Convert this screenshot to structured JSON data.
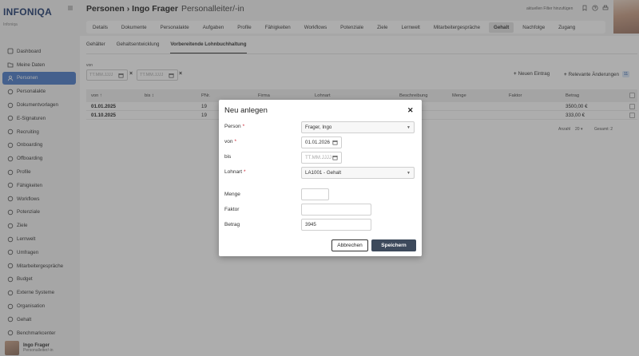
{
  "app": {
    "logo": "INFONIQA",
    "logo_sub": "Infoniqa"
  },
  "sidebar": {
    "items": [
      {
        "label": "Dashboard",
        "icon": "dashboard-icon"
      },
      {
        "label": "Meine Daten",
        "icon": "folder-icon"
      },
      {
        "label": "Personen",
        "icon": "person-icon"
      },
      {
        "label": "Personalakte",
        "icon": "file-icon"
      },
      {
        "label": "Dokumentvorlagen",
        "icon": "template-icon"
      },
      {
        "label": "E-Signaturen",
        "icon": "signature-icon"
      },
      {
        "label": "Recruiting",
        "icon": "recruiting-icon"
      },
      {
        "label": "Onboarding",
        "icon": "onboarding-icon"
      },
      {
        "label": "Offboarding",
        "icon": "offboarding-icon"
      },
      {
        "label": "Profile",
        "icon": "profile-icon"
      },
      {
        "label": "Fähigkeiten",
        "icon": "skills-icon"
      },
      {
        "label": "Workflows",
        "icon": "workflow-icon"
      },
      {
        "label": "Potenziale",
        "icon": "potential-icon"
      },
      {
        "label": "Ziele",
        "icon": "target-icon"
      },
      {
        "label": "Lernwelt",
        "icon": "learning-icon"
      },
      {
        "label": "Umfragen",
        "icon": "survey-icon"
      },
      {
        "label": "Mitarbeitergespräche",
        "icon": "conversation-icon"
      },
      {
        "label": "Budget",
        "icon": "budget-icon"
      },
      {
        "label": "Externe Systeme",
        "icon": "link-icon"
      },
      {
        "label": "Organisation",
        "icon": "organisation-icon"
      },
      {
        "label": "Gehalt",
        "icon": "salary-icon"
      },
      {
        "label": "Benchmarkcenter",
        "icon": "chart-icon"
      }
    ],
    "active_index": 2,
    "user": {
      "name": "Ingo Frager",
      "role": "Personalleiter/-in"
    }
  },
  "header": {
    "breadcrumb": "Personen › Ingo Frager",
    "role": "Personalleiter/-in",
    "filter_text": "aktuellen Filter hinzufügen"
  },
  "tabs": [
    "Details",
    "Dokumente",
    "Personalakte",
    "Aufgaben",
    "Profile",
    "Fähigkeiten",
    "Workflows",
    "Potenziale",
    "Ziele",
    "Lernwelt",
    "Mitarbeitergespräche",
    "Gehalt",
    "Nachfolge",
    "Zugang"
  ],
  "active_tab": "Gehalt",
  "subtabs": [
    "Gehälter",
    "Gehaltsentwicklung",
    "Vorbereitende Lohnbuchhaltung"
  ],
  "filter": {
    "von_label": "von",
    "placeholder": "TT.MM.JJJJ"
  },
  "actions": {
    "new_entry": "Neuen Eintrag",
    "relevant_changes": "Relevante Änderungen",
    "relevant_count": "11"
  },
  "table": {
    "headers": [
      "von ↑",
      "bis ↕",
      "PNr.",
      "Firma",
      "Lohnart",
      "Beschreibung",
      "Menge",
      "Faktor",
      "Betrag"
    ],
    "rows": [
      {
        "von": "01.01.2025",
        "pnr": "19",
        "betrag": "3500,00 €"
      },
      {
        "von": "01.10.2025",
        "pnr": "19",
        "betrag": "333,00 €"
      }
    ]
  },
  "pager": {
    "anzahl_label": "Anzahl",
    "anzahl_value": "20",
    "gesamt": "Gesamt: 2"
  },
  "dialog": {
    "title": "Neu anlegen",
    "fields": {
      "person_label": "Person",
      "person_value": "Frager, Ingo",
      "von_label": "von",
      "von_value": "01.01.2026",
      "bis_label": "bis",
      "bis_placeholder": "TT.MM.JJJJ",
      "lohnart_label": "Lohnart",
      "lohnart_value": "LA1001 - Gehalt",
      "menge_label": "Menge",
      "faktor_label": "Faktor",
      "betrag_label": "Betrag",
      "betrag_value": "3945",
      "required_mark": "*"
    },
    "cancel_label": "Abbrechen",
    "save_label": "Speichern"
  }
}
